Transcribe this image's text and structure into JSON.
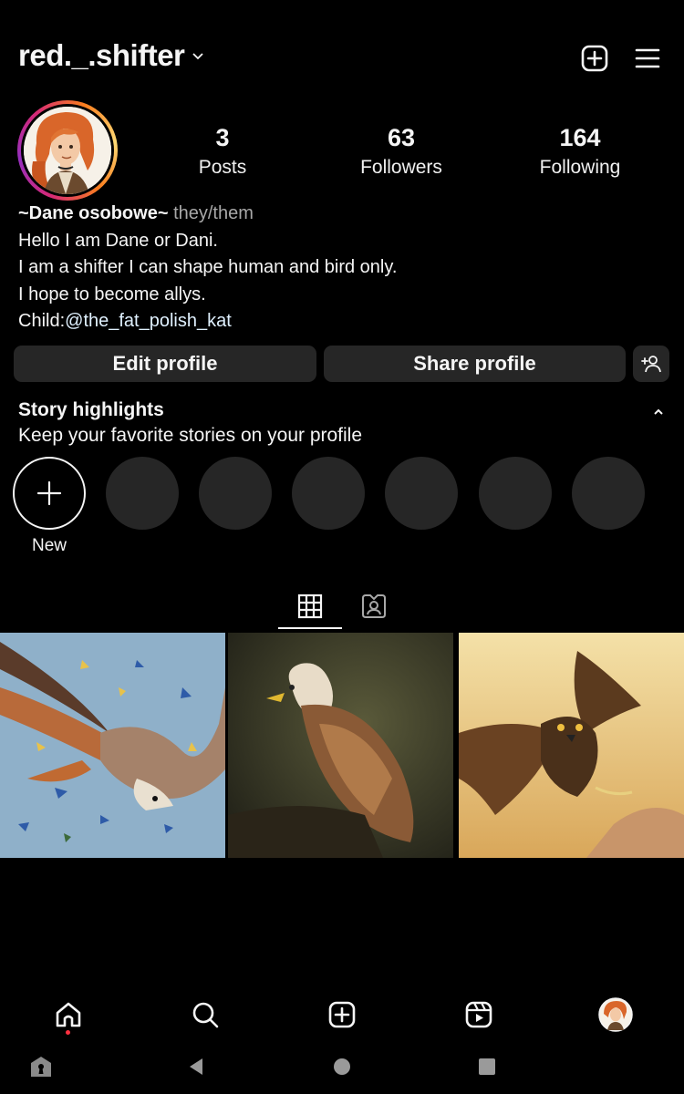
{
  "header": {
    "username": "red._.shifter"
  },
  "stats": [
    {
      "value": "3",
      "label": "Posts"
    },
    {
      "value": "63",
      "label": "Followers"
    },
    {
      "value": "164",
      "label": "Following"
    }
  ],
  "bio": {
    "name": "~Dane osobowe~",
    "pronouns": "they/them",
    "line1": "Hello I am Dane or Dani.",
    "line2": "I am a shifter I can shape human and bird only.",
    "line3": "I hope to become allys.",
    "line4_prefix": "Child:",
    "line4_mention": "@the_fat_polish_kat"
  },
  "buttons": {
    "edit": "Edit profile",
    "share": "Share profile"
  },
  "highlights": {
    "title": "Story highlights",
    "subtitle": "Keep your favorite stories on your profile",
    "new_label": "New"
  },
  "icons": {
    "header": [
      "plus-square-icon",
      "menu-icon"
    ],
    "tabs": [
      "grid-icon",
      "tagged-icon"
    ],
    "nav": [
      "home-icon",
      "search-icon",
      "create-icon",
      "reels-icon",
      "profile-avatar"
    ],
    "system": [
      "keyhole-icon",
      "back-icon",
      "home-dot-icon",
      "recents-icon"
    ]
  },
  "colors": {
    "background": "#000000",
    "button": "#262626",
    "notification_dot": "#ff3040"
  }
}
